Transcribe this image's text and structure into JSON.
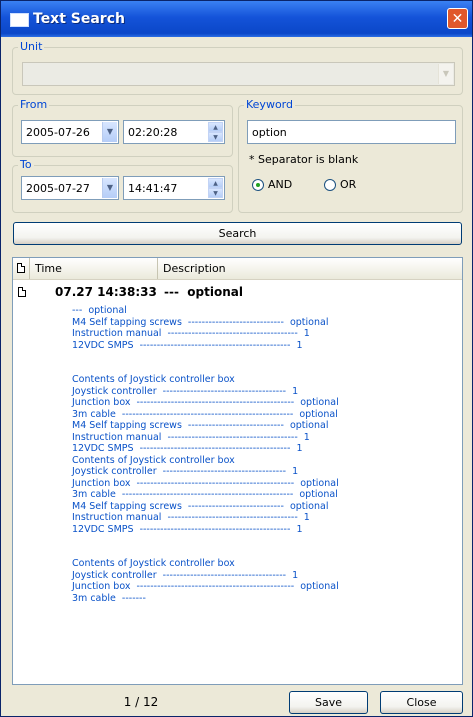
{
  "window": {
    "title": "Text Search",
    "close_glyph": "✕"
  },
  "unit": {
    "label": "Unit",
    "value": ""
  },
  "from": {
    "label": "From",
    "date": "2005-07-26",
    "time": "02:20:28"
  },
  "to": {
    "label": "To",
    "date": "2005-07-27",
    "time": "14:41:47"
  },
  "keyword": {
    "label": "Keyword",
    "value": "option",
    "note": "* Separator is blank",
    "and_label": "AND",
    "or_label": "OR",
    "selected": "AND"
  },
  "search_button": "Search",
  "results": {
    "columns": {
      "time": "Time",
      "description": "Description"
    },
    "row": {
      "time": "07.27 14:38:33",
      "description": "---  optional"
    },
    "detail_lines": [
      "---  optional",
      "M4 Self tapping screws  ----------------------------  optional",
      "Instruction manual  --------------------------------------  1",
      "12VDC SMPS  --------------------------------------------  1",
      "",
      "",
      "Contents of Joystick controller box",
      "Joystick controller  ------------------------------------  1",
      "Junction box  ----------------------------------------------  optional",
      "3m cable  --------------------------------------------------  optional",
      "M4 Self tapping screws  ----------------------------  optional",
      "Instruction manual  --------------------------------------  1",
      "12VDC SMPS  --------------------------------------------  1",
      "Contents of Joystick controller box",
      "Joystick controller  ------------------------------------  1",
      "Junction box  ----------------------------------------------  optional",
      "3m cable  --------------------------------------------------  optional",
      "M4 Self tapping screws  ----------------------------  optional",
      "Instruction manual  --------------------------------------  1",
      "12VDC SMPS  --------------------------------------------  1",
      "",
      "",
      "Contents of Joystick controller box",
      "Joystick controller  ------------------------------------  1",
      "Junction box  ----------------------------------------------  optional",
      "3m cable  -------"
    ]
  },
  "footer": {
    "page": "1 / 12",
    "save": "Save",
    "close": "Close"
  },
  "colors": {
    "title_bar": "#0b47c8",
    "group_label": "#0046d5",
    "detail_text": "#0a52c8"
  }
}
